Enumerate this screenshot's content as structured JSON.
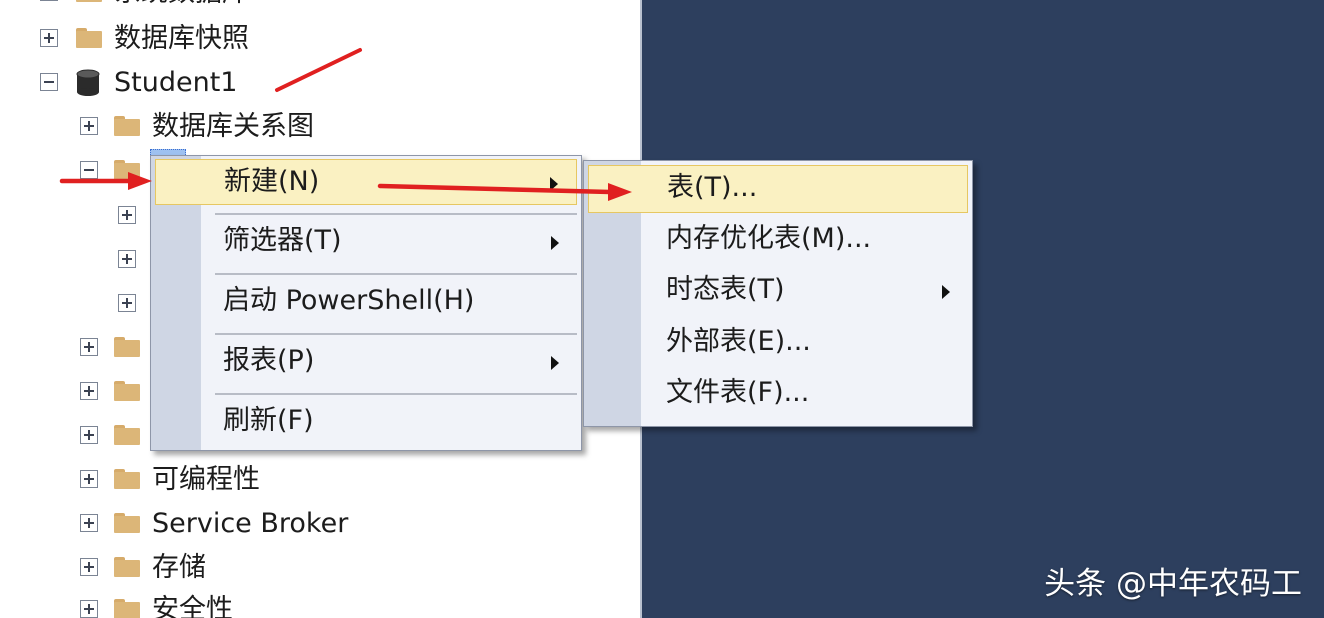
{
  "tree": {
    "nodes": [
      {
        "label": "系统数据库",
        "expander": "plus",
        "icon": "folder-icon"
      },
      {
        "label": "数据库快照",
        "expander": "plus",
        "icon": "folder-icon"
      },
      {
        "label": "Student1",
        "expander": "minus",
        "icon": "database-icon"
      },
      {
        "label": "数据库关系图",
        "expander": "plus",
        "icon": "folder-icon"
      },
      {
        "label": "",
        "expander": "minus",
        "icon": "folder-icon"
      },
      {
        "label": "",
        "expander": "plus",
        "icon": "none"
      },
      {
        "label": "",
        "expander": "plus",
        "icon": "none"
      },
      {
        "label": "",
        "expander": "plus",
        "icon": "none"
      },
      {
        "label": "",
        "expander": "plus",
        "icon": "folder-icon"
      },
      {
        "label": "",
        "expander": "plus",
        "icon": "folder-icon"
      },
      {
        "label": "",
        "expander": "plus",
        "icon": "folder-icon"
      },
      {
        "label": "可编程性",
        "expander": "plus",
        "icon": "folder-icon"
      },
      {
        "label": "Service Broker",
        "expander": "plus",
        "icon": "folder-icon"
      },
      {
        "label": "存储",
        "expander": "plus",
        "icon": "folder-icon"
      },
      {
        "label": "安全性",
        "expander": "plus",
        "icon": "folder-icon"
      }
    ]
  },
  "context_menu": {
    "items": [
      {
        "label": "新建(N)",
        "submenu": true,
        "highlighted": true
      },
      {
        "label": "筛选器(T)",
        "submenu": true
      },
      {
        "label": "启动 PowerShell(H)",
        "submenu": false
      },
      {
        "label": "报表(P)",
        "submenu": true
      },
      {
        "label": "刷新(F)",
        "submenu": false
      }
    ]
  },
  "submenu": {
    "items": [
      {
        "label": "表(T)...",
        "submenu": false,
        "highlighted": true
      },
      {
        "label": "内存优化表(M)...",
        "submenu": false
      },
      {
        "label": "时态表(T)",
        "submenu": true
      },
      {
        "label": "外部表(E)...",
        "submenu": false
      },
      {
        "label": "文件表(F)...",
        "submenu": false
      }
    ]
  },
  "watermark": "头条 @中年农码工",
  "colors": {
    "background": "#2d3f5e",
    "menu_highlight": "#faf1c2",
    "annotation_red": "#e02020",
    "folder": "#dcb678"
  }
}
